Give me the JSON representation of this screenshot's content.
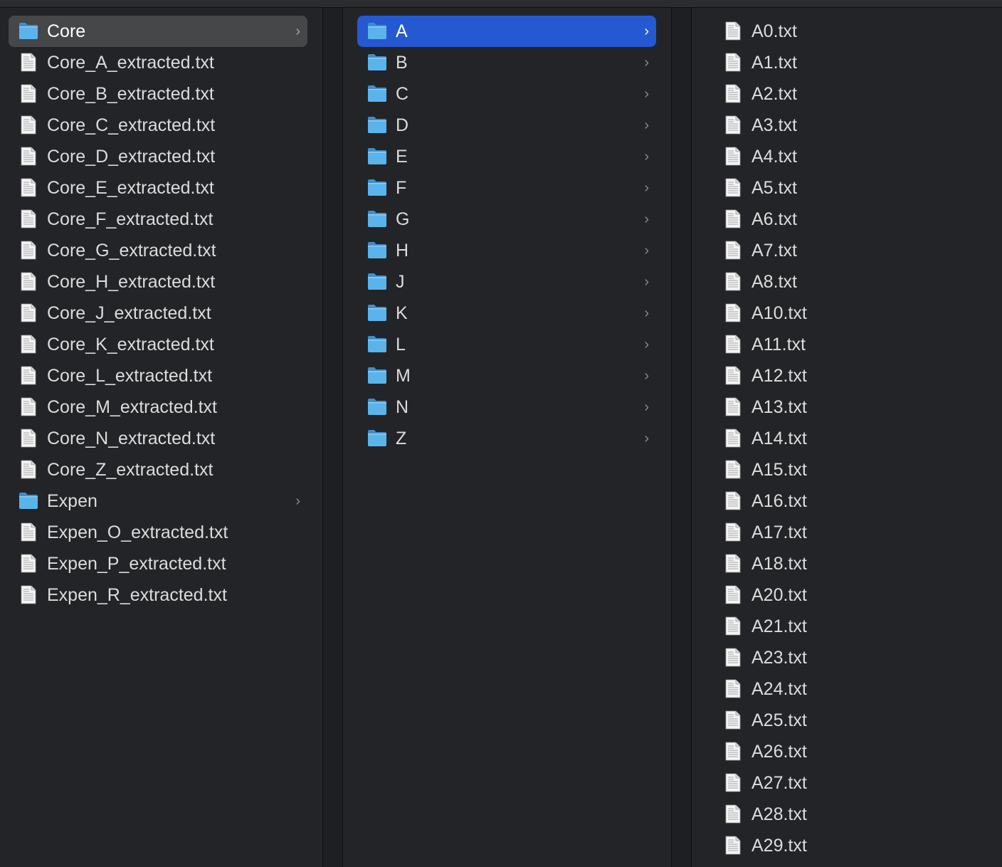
{
  "columns": [
    {
      "items": [
        {
          "name": "Core",
          "type": "folder",
          "state": "selected-inactive"
        },
        {
          "name": "Core_A_extracted.txt",
          "type": "file"
        },
        {
          "name": "Core_B_extracted.txt",
          "type": "file"
        },
        {
          "name": "Core_C_extracted.txt",
          "type": "file"
        },
        {
          "name": "Core_D_extracted.txt",
          "type": "file"
        },
        {
          "name": "Core_E_extracted.txt",
          "type": "file"
        },
        {
          "name": "Core_F_extracted.txt",
          "type": "file"
        },
        {
          "name": "Core_G_extracted.txt",
          "type": "file"
        },
        {
          "name": "Core_H_extracted.txt",
          "type": "file"
        },
        {
          "name": "Core_J_extracted.txt",
          "type": "file"
        },
        {
          "name": "Core_K_extracted.txt",
          "type": "file"
        },
        {
          "name": "Core_L_extracted.txt",
          "type": "file"
        },
        {
          "name": "Core_M_extracted.txt",
          "type": "file"
        },
        {
          "name": "Core_N_extracted.txt",
          "type": "file"
        },
        {
          "name": "Core_Z_extracted.txt",
          "type": "file"
        },
        {
          "name": "Expen",
          "type": "folder"
        },
        {
          "name": "Expen_O_extracted.txt",
          "type": "file"
        },
        {
          "name": "Expen_P_extracted.txt",
          "type": "file"
        },
        {
          "name": "Expen_R_extracted.txt",
          "type": "file"
        }
      ]
    },
    {
      "items": [
        {
          "name": "A",
          "type": "folder",
          "state": "selected-active"
        },
        {
          "name": "B",
          "type": "folder"
        },
        {
          "name": "C",
          "type": "folder"
        },
        {
          "name": "D",
          "type": "folder"
        },
        {
          "name": "E",
          "type": "folder"
        },
        {
          "name": "F",
          "type": "folder"
        },
        {
          "name": "G",
          "type": "folder"
        },
        {
          "name": "H",
          "type": "folder"
        },
        {
          "name": "J",
          "type": "folder"
        },
        {
          "name": "K",
          "type": "folder"
        },
        {
          "name": "L",
          "type": "folder"
        },
        {
          "name": "M",
          "type": "folder"
        },
        {
          "name": "N",
          "type": "folder"
        },
        {
          "name": "Z",
          "type": "folder"
        }
      ]
    },
    {
      "items": [
        {
          "name": "A0.txt",
          "type": "file"
        },
        {
          "name": "A1.txt",
          "type": "file"
        },
        {
          "name": "A2.txt",
          "type": "file"
        },
        {
          "name": "A3.txt",
          "type": "file"
        },
        {
          "name": "A4.txt",
          "type": "file"
        },
        {
          "name": "A5.txt",
          "type": "file"
        },
        {
          "name": "A6.txt",
          "type": "file"
        },
        {
          "name": "A7.txt",
          "type": "file"
        },
        {
          "name": "A8.txt",
          "type": "file"
        },
        {
          "name": "A10.txt",
          "type": "file"
        },
        {
          "name": "A11.txt",
          "type": "file"
        },
        {
          "name": "A12.txt",
          "type": "file"
        },
        {
          "name": "A13.txt",
          "type": "file"
        },
        {
          "name": "A14.txt",
          "type": "file"
        },
        {
          "name": "A15.txt",
          "type": "file"
        },
        {
          "name": "A16.txt",
          "type": "file"
        },
        {
          "name": "A17.txt",
          "type": "file"
        },
        {
          "name": "A18.txt",
          "type": "file"
        },
        {
          "name": "A20.txt",
          "type": "file"
        },
        {
          "name": "A21.txt",
          "type": "file"
        },
        {
          "name": "A23.txt",
          "type": "file"
        },
        {
          "name": "A24.txt",
          "type": "file"
        },
        {
          "name": "A25.txt",
          "type": "file"
        },
        {
          "name": "A26.txt",
          "type": "file"
        },
        {
          "name": "A27.txt",
          "type": "file"
        },
        {
          "name": "A28.txt",
          "type": "file"
        },
        {
          "name": "A29.txt",
          "type": "file"
        }
      ]
    }
  ],
  "icons": {
    "folder": "folder-icon",
    "file": "text-document-icon",
    "disclosure": "chevron-right-icon"
  },
  "colors": {
    "background": "#232427",
    "selection_active": "#2459d1",
    "selection_inactive": "#464749",
    "folder_blue": "#5bb3ec",
    "text": "#dcdcdc"
  }
}
